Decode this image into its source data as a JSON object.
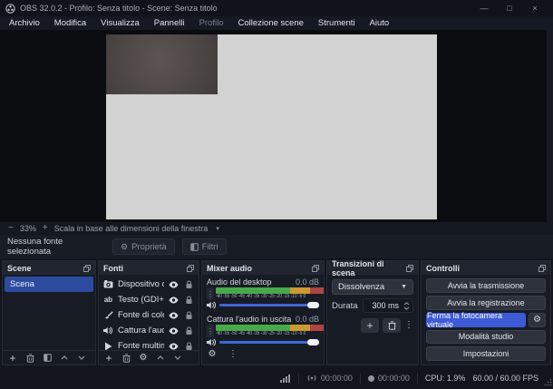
{
  "window": {
    "title": "OBS 32.0.2 - Profilo: Senza titolo - Scene: Senza titolo",
    "controls": {
      "minimize": "—",
      "maximize": "□",
      "close": "×"
    }
  },
  "menu": {
    "items": [
      "Archivio",
      "Modifica",
      "Visualizza",
      "Pannelli",
      "Profilo",
      "Collezione scene",
      "Strumenti",
      "Aiuto"
    ]
  },
  "preview_toolbar": {
    "zoom_out": "−",
    "zoom_level": "33%",
    "zoom_in": "+",
    "scale_mode": "Scala in base alle dimensioni della finestra",
    "dropdown_arrow": "▾"
  },
  "source_toolbar": {
    "status": "Nessuna fonte selezionata",
    "properties_label": "Proprietà",
    "filters_label": "Filtri"
  },
  "scenes_panel": {
    "title": "Scene",
    "items": [
      "Scena"
    ]
  },
  "sources_panel": {
    "title": "Fonti",
    "items": [
      {
        "icon": "video-capture-device-icon",
        "label": "Dispositivo di c"
      },
      {
        "icon": "text-source-icon",
        "label": "Testo (GDI+)"
      },
      {
        "icon": "color-source-icon",
        "label": "Fonte di colore"
      },
      {
        "icon": "audio-capture-icon",
        "label": "Cattura l'audio"
      },
      {
        "icon": "media-source-icon",
        "label": "Fonte multime"
      }
    ],
    "text_icon_glyph": "ab"
  },
  "mixer_panel": {
    "title": "Mixer audio",
    "channels": [
      {
        "name": "Audio del desktop",
        "volume": "0.0 dB"
      },
      {
        "name": "Cattura l'audio in uscita",
        "volume": "0.0 dB"
      }
    ],
    "ticks": [
      "-60",
      "-55",
      "-50",
      "-45",
      "-40",
      "-35",
      "-30",
      "-25",
      "-20",
      "-15",
      "-10",
      "-5",
      "0"
    ]
  },
  "transitions_panel": {
    "title": "Transizioni di scena",
    "selected_transition": "Dissolvenza",
    "duration_label": "Durata",
    "duration_value": "300 ms"
  },
  "controls_panel": {
    "title": "Controlli",
    "buttons": [
      "Avvia la trasmissione",
      "Avvia la registrazione",
      "Ferma la fotocamera virtuale",
      "Modalità studio",
      "Impostazioni"
    ]
  },
  "status_bar": {
    "stream_time": "00:00:00",
    "recording_time": "00:00:00",
    "cpu": "CPU: 1.9%",
    "fps": "60.00 / 60.00 FPS"
  },
  "colors": {
    "accent_blue": "#3d5bd7",
    "selection_blue": "#2d4b9e",
    "meter_green": "#48a948",
    "meter_yellow": "#cc9a2e",
    "meter_red": "#b04343",
    "canvas_gray": "#d2d2d2"
  }
}
